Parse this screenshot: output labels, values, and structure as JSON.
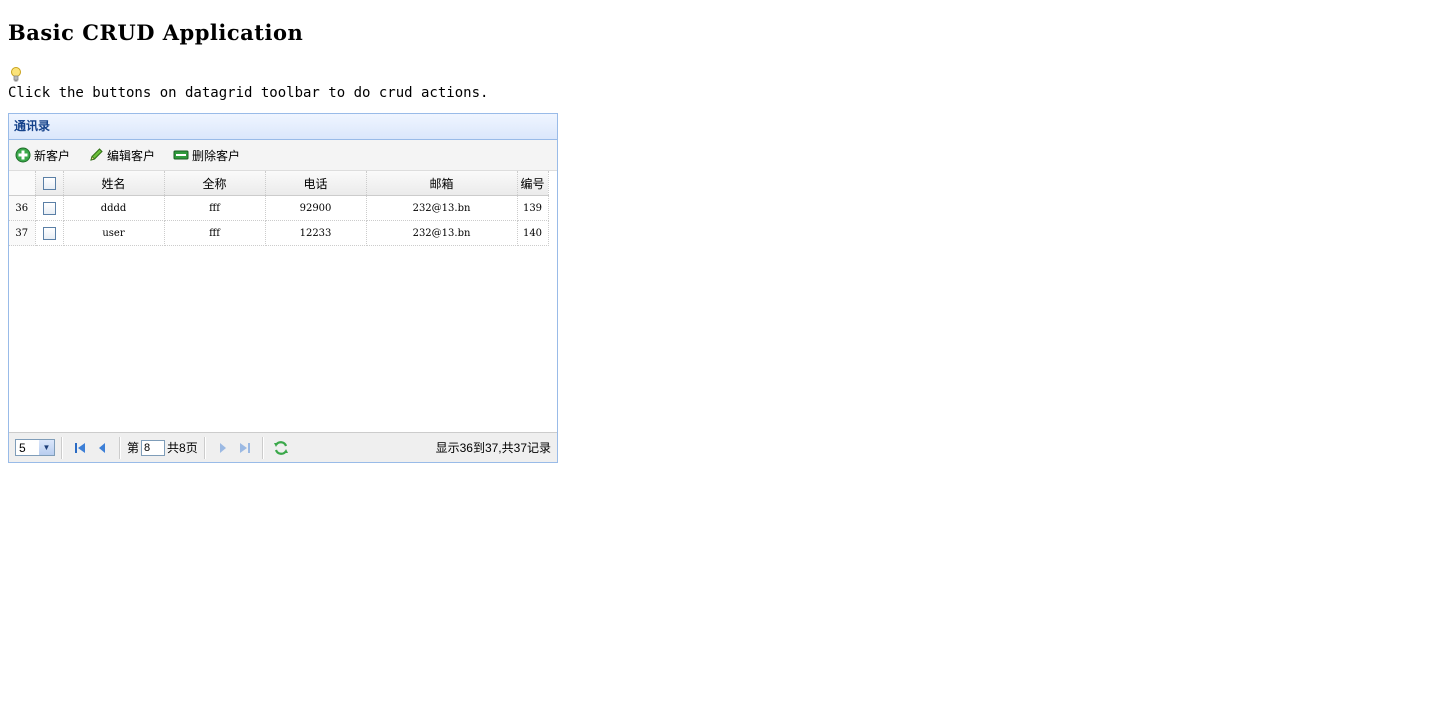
{
  "page": {
    "title": "Basic CRUD Application",
    "description": "Click the buttons on datagrid toolbar to do crud actions."
  },
  "panel": {
    "title": "通讯录"
  },
  "toolbar": {
    "add_label": "新客户",
    "edit_label": "编辑客户",
    "delete_label": "删除客户"
  },
  "grid": {
    "columns": [
      "姓名",
      "全称",
      "电话",
      "邮箱",
      "编号"
    ],
    "rows": [
      {
        "rownum": "36",
        "name": "dddd",
        "fullname": "fff",
        "phone": "92900",
        "email": "232@13.bn",
        "id": "139"
      },
      {
        "rownum": "37",
        "name": "user",
        "fullname": "fff",
        "phone": "12233",
        "email": "232@13.bn",
        "id": "140"
      }
    ]
  },
  "pager": {
    "page_size": "5",
    "page_prefix": "第",
    "current_page": "8",
    "page_total": "共8页",
    "info": "显示36到37,共37记录"
  },
  "colors": {
    "panel_border": "#99bbe8",
    "header_text": "#15428b"
  }
}
